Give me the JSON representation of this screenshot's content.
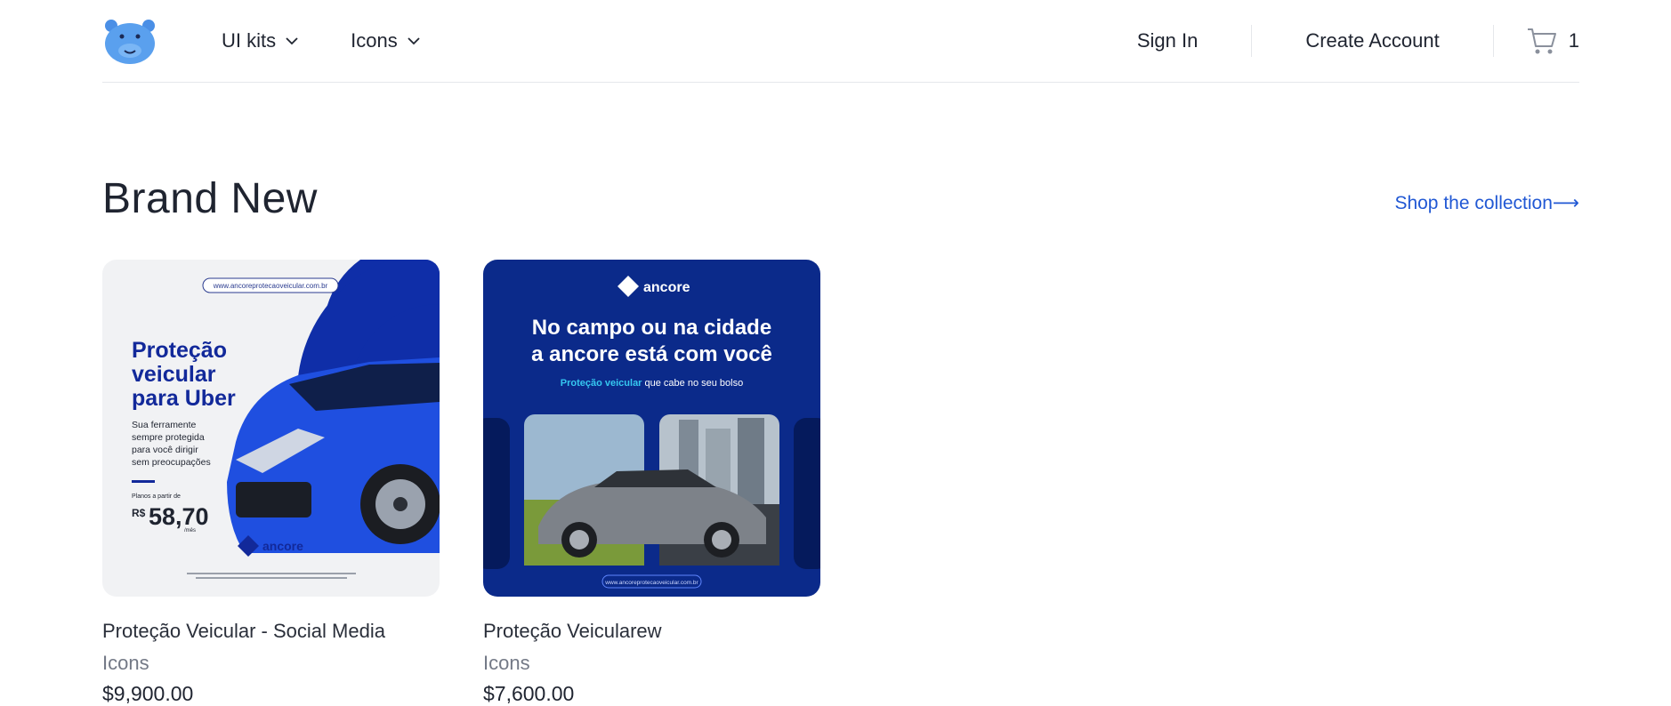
{
  "header": {
    "nav": [
      {
        "label": "UI kits",
        "icon": "chevron-down-icon"
      },
      {
        "label": "Icons",
        "icon": "chevron-down-icon"
      }
    ],
    "sign_in": "Sign In",
    "create_account": "Create Account",
    "cart_count": "1"
  },
  "section": {
    "title": "Brand New",
    "shop_link": "Shop the collection⟶"
  },
  "products": [
    {
      "title": "Proteção Veicular - Social Media",
      "category": "Icons",
      "price": "$9,900.00",
      "image": {
        "url_text": "www.ancoreprotecaoveicular.com.br",
        "headline_1": "Proteção",
        "headline_2": "veicular",
        "headline_3": "para Uber",
        "sub_1": "Sua ferramente",
        "sub_2": "sempre protegida",
        "sub_3": "para você dirigir",
        "sub_4": "sem preocupações",
        "plans_label": "Planos a partir de",
        "currency": "R$",
        "amount": "58,70",
        "per": "/mês",
        "brand": "ancore"
      }
    },
    {
      "title": "Proteção Veicularew",
      "category": "Icons",
      "price": "$7,600.00",
      "image": {
        "brand": "ancore",
        "headline_1": "No campo ou na cidade",
        "headline_2": "a ancore está com você",
        "sub_highlight": "Proteção veicular",
        "sub_rest": " que cabe no seu bolso",
        "url_text": "www.ancoreprotecaoveicular.com.br"
      }
    }
  ],
  "colors": {
    "accent_link": "#2158d4",
    "brand_blue": "#0b2a8a",
    "car_blue": "#1f4fe0"
  }
}
